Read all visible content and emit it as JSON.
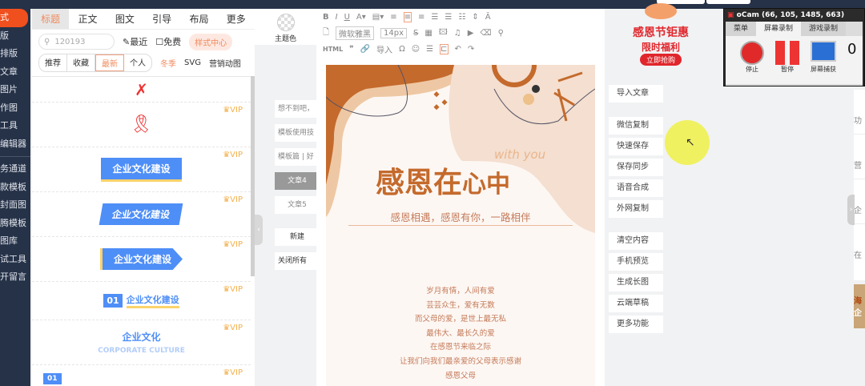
{
  "left_nav": {
    "items": [
      "式",
      "版",
      "排版",
      "文章",
      "图片",
      "作图",
      "工具",
      "编辑器",
      "务通道",
      "款模板",
      "封面图",
      "腾模板",
      "图库",
      "试工具",
      "开留言"
    ]
  },
  "panel": {
    "tabs": [
      "标题",
      "正文",
      "图文",
      "引导",
      "布局",
      "更多"
    ],
    "search_value": "120193",
    "recent": "最近",
    "free": "免费",
    "style_center": "样式中心",
    "seg": [
      "推荐",
      "收藏",
      "最新",
      "个人"
    ],
    "tags": [
      "冬季",
      "SVG",
      "营销动图"
    ],
    "vip": "VIP",
    "cards": [
      "企业文化建设",
      "企业文化建设",
      "企业文化建设",
      "企业文化建设",
      "企业文化",
      "CORPORATE CULTURE",
      "01"
    ]
  },
  "theme": {
    "label": "主题色"
  },
  "articles": [
    "想不到吧，",
    "模板使用技",
    "模板篇 | 好",
    "文章4",
    "文章5",
    "新建",
    "关闭所有"
  ],
  "toolbar": {
    "font": "微软雅黑",
    "size": "14px",
    "html": "HTML",
    "import": "导入"
  },
  "canvas": {
    "with_you": "with you",
    "title_a": "感恩在",
    "title_b": "心中",
    "subtitle": "感恩相遇，感恩有你，一路相伴",
    "poem": [
      "岁月有情，人间有爱",
      "芸芸众生，爱有无数",
      "而父母的爱，是世上最无私",
      "最伟大、最长久的爱",
      "在感恩节来临之际",
      "让我们向我们最亲爱的父母表示感谢",
      "感恩父母"
    ]
  },
  "right_buttons": [
    "导入文章",
    "微信复制",
    "快速保存",
    "保存同步",
    "语音合成",
    "外网复制",
    "清空内容",
    "手机预览",
    "生成长图",
    "云端草稿",
    "更多功能"
  ],
  "promo": {
    "line1": "感恩节钜惠",
    "line2": "限时福利",
    "cta": "立即抢购"
  },
  "ocam": {
    "title": "oCam (66, 105, 1485, 663)",
    "tabs": [
      "菜单",
      "屏幕录制",
      "游戏录制"
    ],
    "stop": "停止",
    "pause": "暂停",
    "capture": "屏幕捕获",
    "extra": "0"
  },
  "right_panel": {
    "items": [
      "功",
      "营",
      "企",
      "在"
    ],
    "banner": [
      "海",
      "企"
    ]
  }
}
